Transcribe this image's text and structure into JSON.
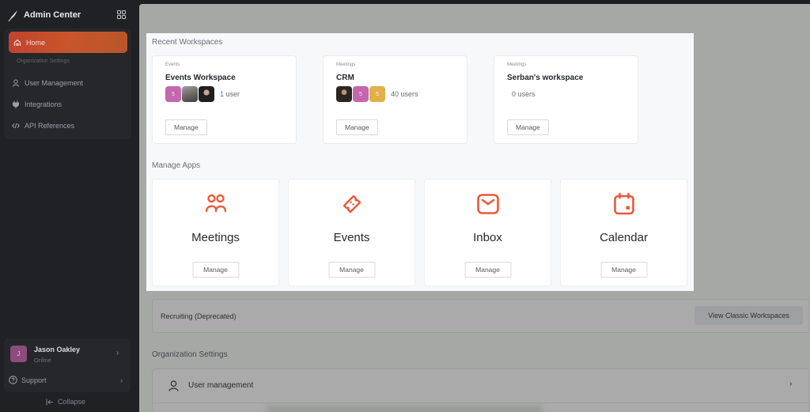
{
  "sidebar": {
    "brand": "Admin Center",
    "apps_icon": "grid-apps-icon",
    "nav": {
      "home": "Home",
      "section_label": "Organization Settings",
      "items": [
        {
          "label": "User Management",
          "icon": "user-icon"
        },
        {
          "label": "Integrations",
          "icon": "plug-icon"
        },
        {
          "label": "API References",
          "icon": "code-icon"
        }
      ]
    },
    "user": {
      "initial": "J",
      "name": "Jason Oakley",
      "status": "Online"
    },
    "support": "Support",
    "collapse": "Collapse"
  },
  "recent_workspaces": {
    "title": "Recent Workspaces",
    "cards": [
      {
        "type": "Events",
        "name": "Events Workspace",
        "avatars": [
          "5",
          "photo",
          "photo"
        ],
        "users": "1 user",
        "button": "Manage"
      },
      {
        "type": "Meetings",
        "name": "CRM",
        "avatars": [
          "photo",
          "5",
          "5"
        ],
        "users": "40 users",
        "button": "Manage"
      },
      {
        "type": "Meetings",
        "name": "Serban's workspace",
        "avatars": [],
        "users": "0 users",
        "button": "Manage"
      }
    ]
  },
  "manage_apps": {
    "title": "Manage Apps",
    "apps": [
      {
        "name": "Meetings",
        "icon": "users-icon",
        "button": "Manage"
      },
      {
        "name": "Events",
        "icon": "ticket-icon",
        "button": "Manage"
      },
      {
        "name": "Inbox",
        "icon": "mail-icon",
        "button": "Manage"
      },
      {
        "name": "Calendar",
        "icon": "calendar-icon",
        "button": "Manage"
      }
    ],
    "accent_color": "#ea5a3b"
  },
  "legacy": {
    "label": "Recruiting (Deprecated)",
    "button": "View Classic Workspaces"
  },
  "org_settings": {
    "title": "Organization Settings",
    "rows": [
      {
        "label": "User management",
        "icon": "user-icon"
      }
    ]
  }
}
